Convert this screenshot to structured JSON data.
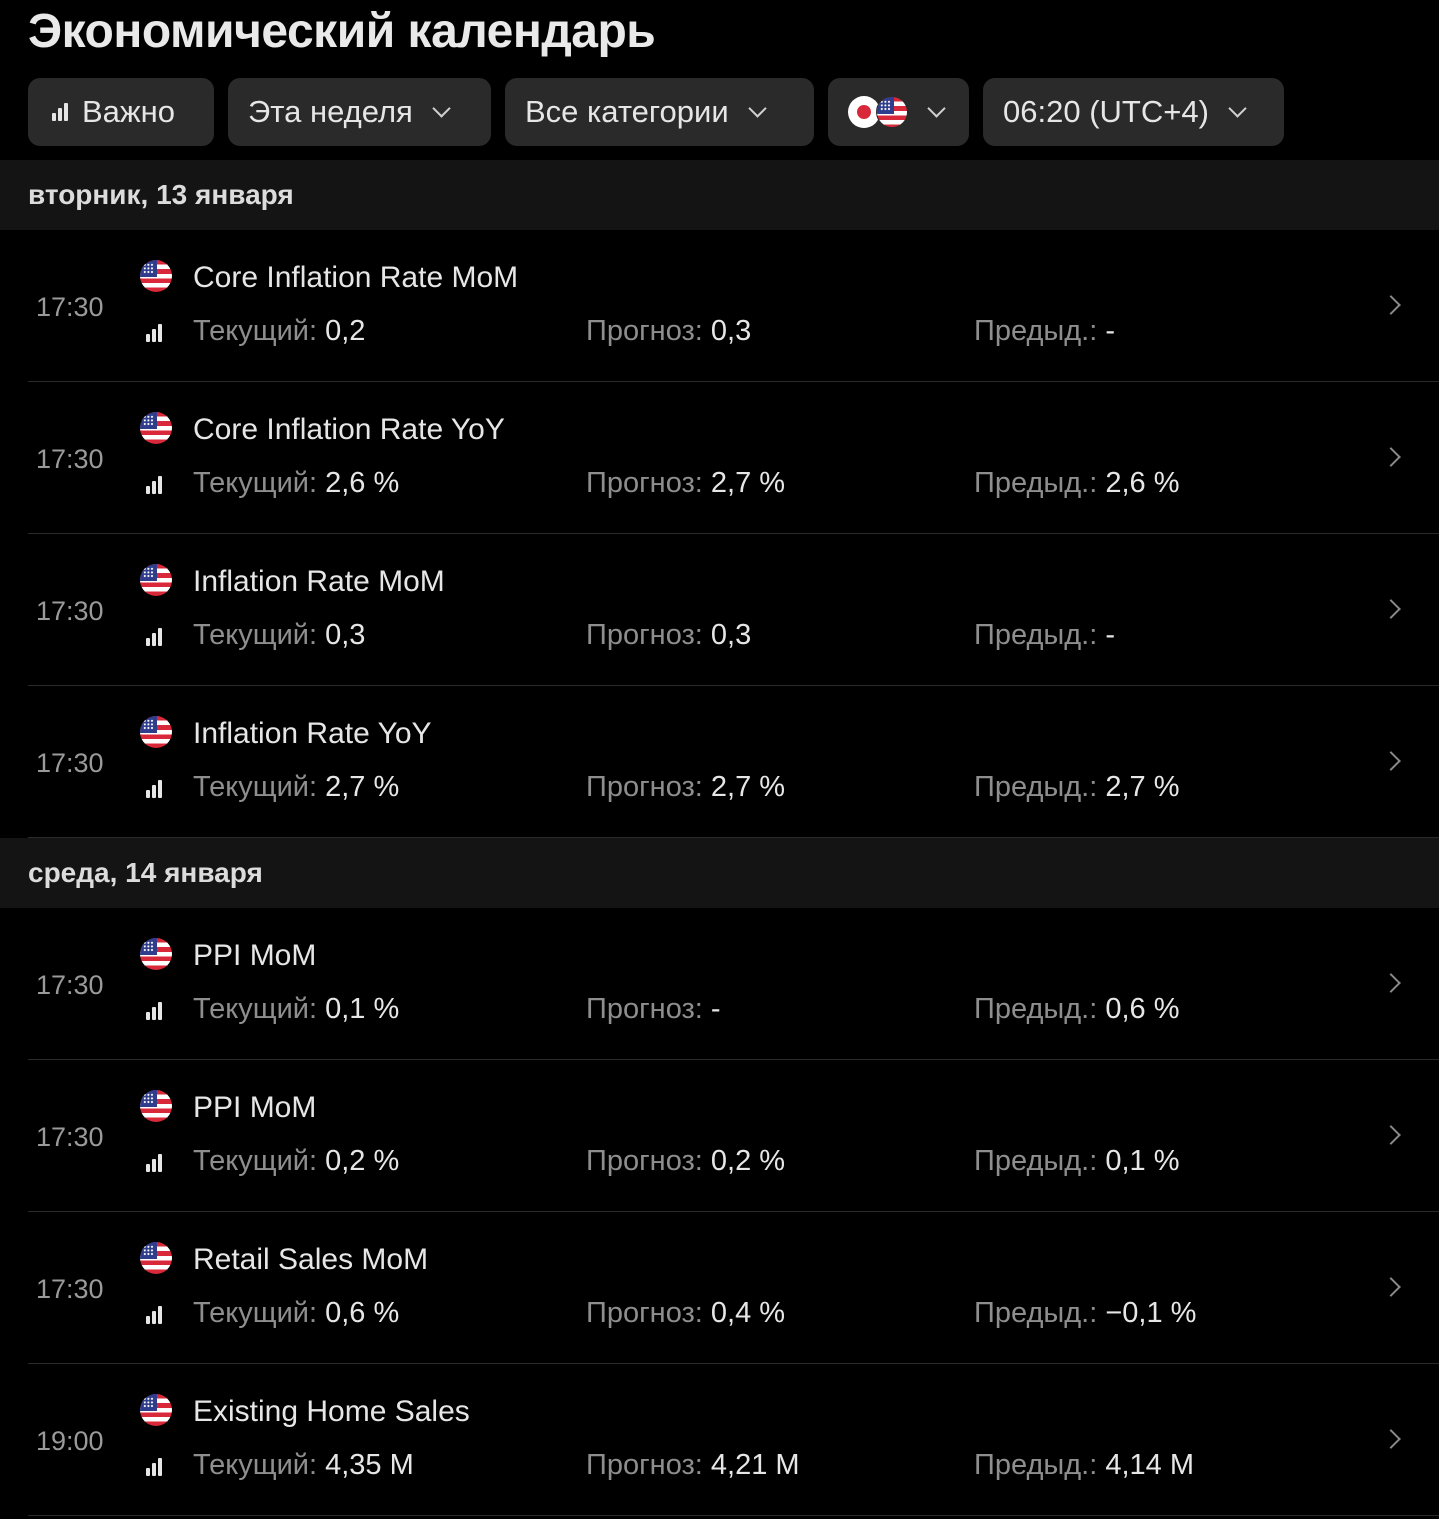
{
  "page_title": "Экономический календарь",
  "filters": {
    "importance": "Важно",
    "period": "Эта неделя",
    "category": "Все категории",
    "countries": [
      "Japan",
      "United States"
    ],
    "time": "06:20 (UTC+4)"
  },
  "labels": {
    "current": "Текущий:",
    "forecast": "Прогноз:",
    "previous": "Предыд.:"
  },
  "days": [
    {
      "header": "вторник, 13 января",
      "events": [
        {
          "time": "17:30",
          "name": "Core Inflation Rate MoM",
          "current": "0,2",
          "forecast": "0,3",
          "previous": "-"
        },
        {
          "time": "17:30",
          "name": "Core Inflation Rate YoY",
          "current": "2,6 %",
          "forecast": "2,7 %",
          "previous": "2,6 %"
        },
        {
          "time": "17:30",
          "name": "Inflation Rate MoM",
          "current": "0,3",
          "forecast": "0,3",
          "previous": "-"
        },
        {
          "time": "17:30",
          "name": "Inflation Rate YoY",
          "current": "2,7 %",
          "forecast": "2,7 %",
          "previous": "2,7 %"
        }
      ]
    },
    {
      "header": "среда, 14 января",
      "events": [
        {
          "time": "17:30",
          "name": "PPI MoM",
          "current": "0,1 %",
          "forecast": "-",
          "previous": "0,6 %"
        },
        {
          "time": "17:30",
          "name": "PPI MoM",
          "current": "0,2 %",
          "forecast": "0,2 %",
          "previous": "0,1 %"
        },
        {
          "time": "17:30",
          "name": "Retail Sales MoM",
          "current": "0,6 %",
          "forecast": "0,4 %",
          "previous": "−0,1 %"
        },
        {
          "time": "19:00",
          "name": "Existing Home Sales",
          "current": "4,35 M",
          "forecast": "4,21 M",
          "previous": "4,14 M"
        }
      ]
    }
  ]
}
